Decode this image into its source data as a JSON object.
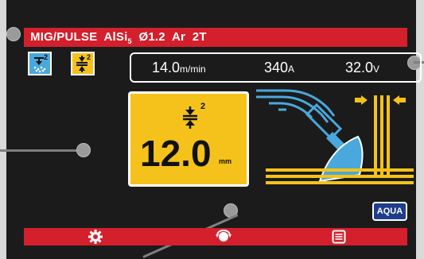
{
  "title_bar": {
    "mode": "MIG/PULSE",
    "material": "AlSi",
    "material_sub": "5",
    "diameter": "Ø1.2",
    "gas": "Ar",
    "trigger": "2T"
  },
  "mode_icons": [
    {
      "name": "pulse-spray-icon",
      "sup": "2"
    },
    {
      "name": "thickness-icon",
      "sup": "2"
    }
  ],
  "params": {
    "wire_speed": "14.0",
    "wire_speed_unit": "m/min",
    "current": "340",
    "current_unit": "A",
    "voltage": "32.0",
    "voltage_unit": "V"
  },
  "main_value": {
    "icon": "thickness-icon",
    "sup": "2",
    "value": "12.0",
    "unit": "mm"
  },
  "aqua": {
    "label": "AQUA"
  },
  "bottom_bar": {
    "items": [
      {
        "icon": "gear-icon"
      },
      {
        "icon": "rotate-icon"
      },
      {
        "icon": "menu-list-icon"
      }
    ]
  },
  "colors": {
    "red": "#d41f2c",
    "yellow": "#f4c21a",
    "blue": "#4aa8dc",
    "screen": "#1b1b1b"
  }
}
